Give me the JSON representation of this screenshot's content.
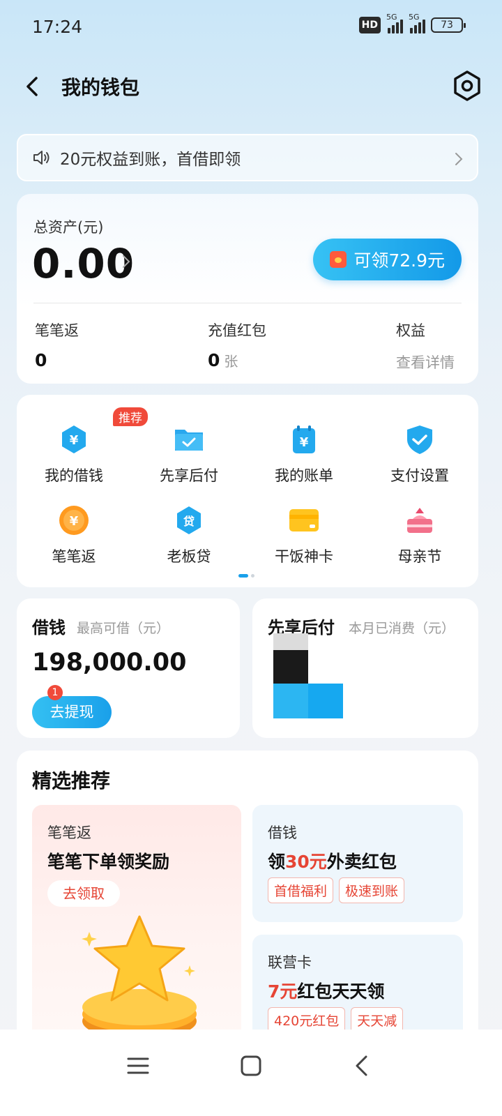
{
  "status_bar": {
    "time": "17:24",
    "hd": "HD",
    "net1": "5G",
    "net2": "5G",
    "battery": "73"
  },
  "header": {
    "title": "我的钱包"
  },
  "notice": {
    "text": "20元权益到账，首借即领"
  },
  "assets": {
    "label": "总资产(元)",
    "value": "0.00",
    "claim_button": "可领72.9元",
    "stats": [
      {
        "label": "笔笔返",
        "value": "0"
      },
      {
        "label": "充值红包",
        "value": "0",
        "unit": "张"
      },
      {
        "label": "权益",
        "link": "查看详情"
      }
    ]
  },
  "grid": {
    "items": [
      {
        "label": "我的借钱",
        "icon": "loan-hex-icon",
        "badge": "推荐"
      },
      {
        "label": "先享后付",
        "icon": "folder-check-icon"
      },
      {
        "label": "我的账单",
        "icon": "bill-calendar-icon"
      },
      {
        "label": "支付设置",
        "icon": "shield-check-icon"
      },
      {
        "label": "笔笔返",
        "icon": "coin-icon"
      },
      {
        "label": "老板贷",
        "icon": "loan-badge-icon"
      },
      {
        "label": "干饭神卡",
        "icon": "card-icon"
      },
      {
        "label": "母亲节",
        "icon": "cake-icon"
      }
    ],
    "page_indicator": {
      "pages": 2,
      "current": 1
    }
  },
  "loan_card": {
    "title": "借钱",
    "subtitle": "最高可借（元）",
    "amount": "198,000.00",
    "button": "去提现",
    "badge": "1"
  },
  "bnpl_card": {
    "title": "先享后付",
    "subtitle": "本月已消费（元）"
  },
  "recommend": {
    "title": "精选推荐",
    "card1": {
      "category": "笔笔返",
      "headline": "笔笔下单领奖励",
      "button": "去领取"
    },
    "card2": {
      "category": "借钱",
      "headline_pre": "领",
      "headline_highlight": "30元",
      "headline_post": "外卖红包",
      "tags": [
        "首借福利",
        "极速到账"
      ]
    },
    "card3": {
      "category": "联营卡",
      "headline_highlight": "7元",
      "headline_post": "红包天天领",
      "tags": [
        "420元红包",
        "天天减"
      ]
    }
  },
  "colors": {
    "accent": "#1aa0ea",
    "red": "#e64535"
  }
}
